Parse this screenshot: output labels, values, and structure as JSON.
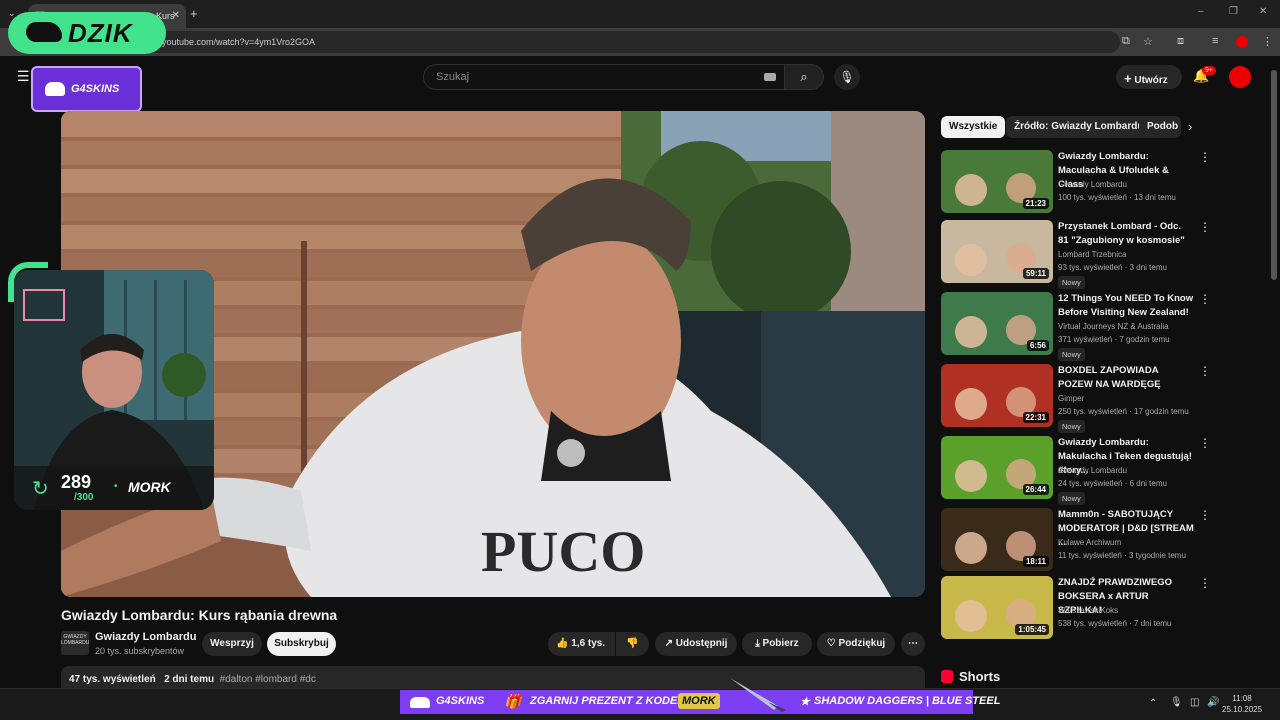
{
  "browser": {
    "tab_title": "(541) Gwiazdy Lombardu: Kurs",
    "url": "youtube.com/watch?v=4ym1Vro2GOA"
  },
  "overlays": {
    "dzik_label": "DZIK",
    "g4skins_label": "G4SKINS",
    "cam_count": "289",
    "cam_total": "/300",
    "cam_name": "MORK",
    "banner": {
      "brand": "G4SKINS",
      "promo": "ZGARNIJ PREZENT Z KODEM",
      "code": "MORK",
      "item": "SHADOW DAGGERS | BLUE STEEL"
    }
  },
  "header": {
    "search_placeholder": "Szukaj",
    "create_label": "Utwórz",
    "notif_badge": "9+"
  },
  "video": {
    "title": "Gwiazdy Lombardu: Kurs rąbania drewna",
    "channel_logo_text": "GWIAZDY LOMBARDU",
    "channel": "Gwiazdy Lombardu",
    "subscribers": "20 tys. subskrybentów",
    "support_label": "Wesprzyj",
    "subscribe_label": "Subskrybuj",
    "likes": "1,6 tys.",
    "share_label": "Udostępnij",
    "download_label": "Pobierz",
    "thanks_label": "Podziękuj",
    "views": "47 tys. wyświetleń",
    "age": "2 dni temu",
    "hashtags": "#dalton #lombard #dc"
  },
  "chips": [
    "Wszystkie",
    "Źródło: Gwiazdy Lombardu",
    "Podob"
  ],
  "recommendations": [
    {
      "title": "Gwiazdy Lombardu: Maculacha & Ufoludek & Class",
      "channel": "Gwiazdy Lombardu",
      "meta": "100 tys. wyświetleń · 13 dni temu",
      "duration": "21:23",
      "badge": "",
      "thumb_color": "#4a7a3a"
    },
    {
      "title": "Przystanek Lombard - Odc. 81 \"Zagubiony w kosmosie\"",
      "channel": "Lombard Trzebnica",
      "meta": "93 tys. wyświetleń · 3 dni temu",
      "duration": "59:11",
      "badge": "Nowy",
      "thumb_color": "#c9b8a0"
    },
    {
      "title": "12 Things You NEED To Know Before Visiting New Zealand!",
      "channel": "Virtual Journeys NZ & Australia",
      "meta": "371 wyświetleń · 7 godzin temu",
      "duration": "6:56",
      "badge": "Nowy",
      "thumb_color": "#3f7a4a"
    },
    {
      "title": "BOXDEL ZAPOWIADA POZEW NA WARDĘGĘ",
      "channel": "Gimper",
      "meta": "250 tys. wyświetleń · 17 godzin temu",
      "duration": "22:31",
      "badge": "Nowy",
      "thumb_color": "#b03024"
    },
    {
      "title": "Gwiazdy Lombardu: Makulacha i Teken degustują! #fory...",
      "channel": "Gwiazdy Lombardu",
      "meta": "24 tys. wyświetleń · 6 dni temu",
      "duration": "26:44",
      "badge": "Nowy",
      "thumb_color": "#5aa02a"
    },
    {
      "title": "Mamm0n - SABOTUJĄCY MODERATOR | D&D [STREAM ...",
      "channel": "Kulawe Archiwum",
      "meta": "11 tys. wyświetleń · 3 tygodnie temu",
      "duration": "18:11",
      "badge": "",
      "thumb_color": "#3a2a1a"
    },
    {
      "title": "ZNAJDŹ PRAWDZIWEGO BOKSERA x ARTUR SZPILKA!",
      "channel": "WarszawskiKoks",
      "meta": "538 tys. wyświetleń · 7 dni temu",
      "duration": "1:05:45",
      "badge": "",
      "thumb_color": "#c8b84a"
    }
  ],
  "shorts_label": "Shorts",
  "clock": {
    "time": "11:08",
    "date": "25.10.2025"
  }
}
